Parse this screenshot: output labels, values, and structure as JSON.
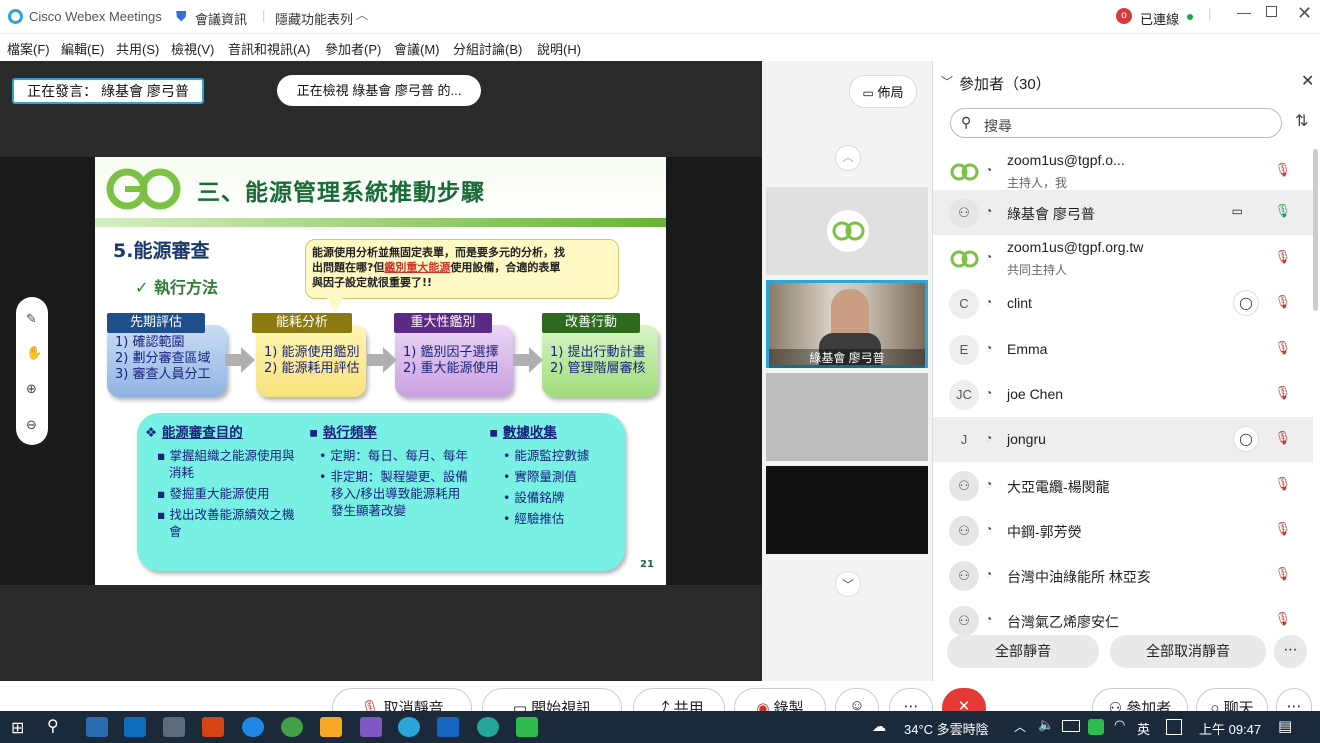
{
  "app": {
    "title": "Cisco Webex Meetings",
    "meeting_info": "會議資訊",
    "hidden_toolbar": "隱藏功能表列",
    "connected": "已連線"
  },
  "menu": [
    "檔案(F)",
    "編輯(E)",
    "共用(S)",
    "檢視(V)",
    "音訊和視訊(A)",
    "參加者(P)",
    "會議(M)",
    "分組討論(B)",
    "說明(H)"
  ],
  "stage": {
    "speaking": "正在發言： 綠基會 廖弓普",
    "viewing": "正在檢視 綠基會 廖弓普 的...",
    "layout_btn": "佈局"
  },
  "slide": {
    "title": "三、能源管理系統推動步驟",
    "heading": "5.能源審查",
    "sub": "✓ 執行方法",
    "callout_1": "能源使用分析並無固定表單，而是要多元的分析，找",
    "callout_2a": "出問題在哪?但",
    "callout_2b": "鑑別重大能源",
    "callout_2c": "使用設備，合適的表單",
    "callout_3": "與因子設定就很重要了!!",
    "steps": [
      {
        "head": "先期評估",
        "lines": [
          "1) 確認範圍",
          "2) 劃分審查區域",
          "3) 審查人員分工"
        ]
      },
      {
        "head": "能耗分析",
        "lines": [
          "1) 能源使用鑑別",
          "2) 能源耗用評估"
        ]
      },
      {
        "head": "重大性鑑別",
        "lines": [
          "1) 鑑別因子選擇",
          "2) 重大能源使用"
        ]
      },
      {
        "head": "改善行動",
        "lines": [
          "1) 提出行動計畫",
          "2) 管理階層審核"
        ]
      }
    ],
    "col1": {
      "head": "能源審查目的",
      "items": [
        "掌握組織之能源使用與消耗",
        "發掘重大能源使用",
        "找出改善能源績效之機會"
      ]
    },
    "col2": {
      "head": "執行頻率",
      "items": [
        "定期：每日、每月、每年",
        "非定期：製程變更、設備移入/移出導致能源耗用發生顯著改變"
      ]
    },
    "col3": {
      "head": "數據收集",
      "items": [
        "能源監控數據",
        "實際量測值",
        "設備銘牌",
        "經驗推估"
      ]
    },
    "page": "21"
  },
  "strip": {
    "video_name": "綠基會 廖弓普"
  },
  "panel": {
    "title": "參加者（30）",
    "search_placeholder": "搜尋",
    "participants": [
      {
        "initial": "",
        "name": "zoom1us@tgpf.o...",
        "sub": "主持人，我"
      },
      {
        "initial": "",
        "name": "綠基會 廖弓普",
        "sub": ""
      },
      {
        "initial": "",
        "name": "zoom1us@tgpf.org.tw",
        "sub": "共同主持人"
      },
      {
        "initial": "C",
        "name": "clint",
        "sub": ""
      },
      {
        "initial": "E",
        "name": "Emma",
        "sub": ""
      },
      {
        "initial": "JC",
        "name": "joe Chen",
        "sub": ""
      },
      {
        "initial": "J",
        "name": "jongru",
        "sub": ""
      },
      {
        "initial": "",
        "name": "大亞電纜-楊閔龍",
        "sub": ""
      },
      {
        "initial": "",
        "name": "中鋼-郭芳熒",
        "sub": ""
      },
      {
        "initial": "",
        "name": "台灣中油綠能所 林亞亥",
        "sub": ""
      },
      {
        "initial": "",
        "name": "台灣氣乙烯廖安仁",
        "sub": ""
      }
    ],
    "mute_all": "全部靜音",
    "unmute_all": "全部取消靜音"
  },
  "controls": {
    "unmute": "取消靜音",
    "start_video": "開始視訊",
    "share": "共用",
    "record": "錄製",
    "participants": "參加者",
    "chat": "聊天"
  },
  "taskbar": {
    "weather": "34°C 多雲時陰",
    "ime": "英",
    "time": "上午 09:47"
  }
}
